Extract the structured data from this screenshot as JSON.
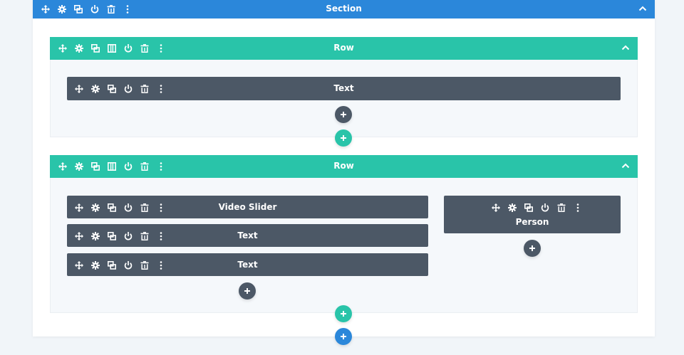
{
  "section": {
    "title": "Section",
    "color": "#2b87da",
    "toolbar": [
      "move-icon",
      "gear-icon",
      "duplicate-icon",
      "power-icon",
      "trash-icon",
      "more-icon"
    ]
  },
  "rows": [
    {
      "title": "Row",
      "color": "#29c4a9",
      "toolbar": [
        "move-icon",
        "gear-icon",
        "duplicate-icon",
        "columns-icon",
        "power-icon",
        "trash-icon",
        "more-icon"
      ],
      "columns": [
        {
          "modules": [
            {
              "title": "Text"
            }
          ]
        }
      ]
    },
    {
      "title": "Row",
      "color": "#29c4a9",
      "toolbar": [
        "move-icon",
        "gear-icon",
        "duplicate-icon",
        "columns-icon",
        "power-icon",
        "trash-icon",
        "more-icon"
      ],
      "columns": [
        {
          "modules": [
            {
              "title": "Video Slider"
            },
            {
              "title": "Text"
            },
            {
              "title": "Text"
            }
          ]
        },
        {
          "modules": [
            {
              "title": "Person"
            }
          ]
        }
      ]
    }
  ],
  "module_toolbar": [
    "move-icon",
    "gear-icon",
    "duplicate-icon",
    "power-icon",
    "trash-icon",
    "more-icon"
  ],
  "colors": {
    "module": "#4c5866",
    "add_module": "#4c5866",
    "add_row": "#29c4a9",
    "add_section": "#2b87da"
  }
}
